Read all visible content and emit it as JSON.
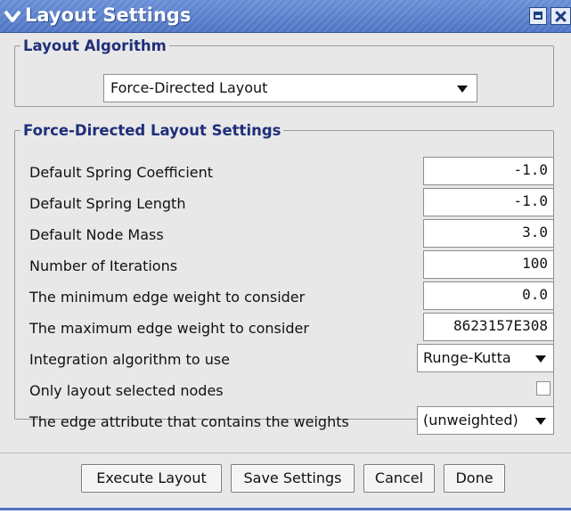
{
  "window": {
    "title": "Layout Settings"
  },
  "algorithm_group": {
    "legend": "Layout Algorithm",
    "selected": "Force-Directed Layout"
  },
  "settings_group": {
    "legend": "Force-Directed Layout Settings",
    "fields": [
      {
        "label": "Default Spring Coefficient",
        "value": "-1.0"
      },
      {
        "label": "Default Spring Length",
        "value": "-1.0"
      },
      {
        "label": "Default Node Mass",
        "value": "3.0"
      },
      {
        "label": "Number of Iterations",
        "value": "100"
      },
      {
        "label": "The minimum edge weight to consider",
        "value": "0.0"
      },
      {
        "label": "The maximum edge weight to consider",
        "value": "8623157E308"
      }
    ],
    "integration": {
      "label": "Integration algorithm to use",
      "selected": "Runge-Kutta"
    },
    "only_selected": {
      "label": "Only layout selected nodes",
      "checked": false
    },
    "weight_attribute": {
      "label": "The edge attribute that contains the weights",
      "selected": "(unweighted)"
    }
  },
  "buttons": {
    "execute": "Execute Layout",
    "save": "Save Settings",
    "cancel": "Cancel",
    "done": "Done"
  },
  "icons": [
    "chevron-down-icon",
    "minimize-icon",
    "close-icon",
    "dropdown-arrow-icon"
  ],
  "colors": {
    "titlebar": "#5b80cc",
    "legend_text": "#1f2f7a",
    "background": "#e8e8e8"
  }
}
